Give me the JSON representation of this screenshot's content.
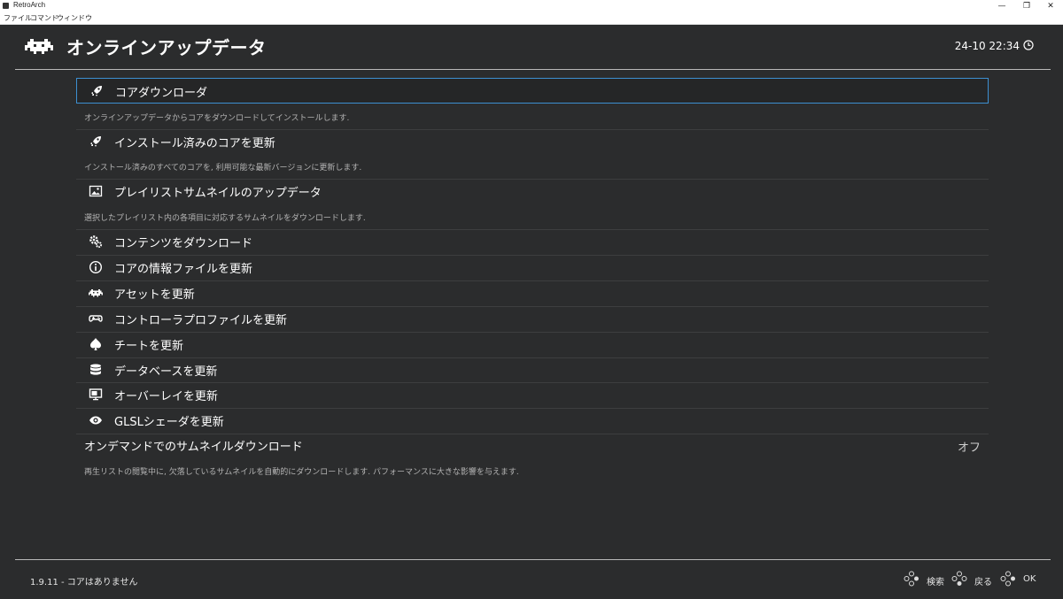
{
  "window": {
    "title": "RetroArch",
    "minimize": "—",
    "restore": "❐",
    "close": "✕",
    "menu": [
      "ファイル",
      "コマンド",
      "ウィンドウ"
    ]
  },
  "header": {
    "icon": "invader-icon",
    "title": "オンラインアップデータ",
    "clock": "24-10 22:34",
    "clock_icon": "clock-icon"
  },
  "entries": [
    {
      "label": "コアダウンローダ",
      "icon": "rocket-icon",
      "selected": true,
      "description": "オンラインアップデータからコアをダウンロードしてインストールします."
    },
    {
      "label": "インストール済みのコアを更新",
      "icon": "rocket-icon",
      "description": "インストール済みのすべてのコアを, 利用可能な最新バージョンに更新します."
    },
    {
      "label": "プレイリストサムネイルのアップデータ",
      "icon": "image-icon",
      "description": "選択したプレイリスト内の各項目に対応するサムネイルをダウンロードします."
    },
    {
      "label": "コンテンツをダウンロード",
      "icon": "gears-icon"
    },
    {
      "label": "コアの情報ファイルを更新",
      "icon": "info-icon"
    },
    {
      "label": "アセットを更新",
      "icon": "invader-icon"
    },
    {
      "label": "コントローラプロファイルを更新",
      "icon": "gamepad-icon"
    },
    {
      "label": "チートを更新",
      "icon": "spade-icon"
    },
    {
      "label": "データベースを更新",
      "icon": "database-icon"
    },
    {
      "label": "オーバーレイを更新",
      "icon": "monitor-icon"
    },
    {
      "label": "GLSLシェーダを更新",
      "icon": "eye-icon"
    }
  ],
  "setting": {
    "label": "オンデマンドでのサムネイルダウンロード",
    "value": "オフ",
    "description": "再生リストの閲覧中に, 欠落しているサムネイルを自動的にダウンロードします. パフォーマンスに大きな影響を与えます."
  },
  "footer": {
    "version": "1.9.11 - コアはありません",
    "buttons": [
      {
        "label": "検索",
        "icon": "gamepad-buttons-icon"
      },
      {
        "label": "戻る",
        "icon": "gamepad-buttons-icon"
      },
      {
        "label": "OK",
        "icon": "gamepad-buttons-icon"
      }
    ]
  },
  "colors": {
    "background": "#2b2c2d",
    "selection_border": "#3d8fd1",
    "text": "#ffffff",
    "description": "#b4b4b4"
  }
}
